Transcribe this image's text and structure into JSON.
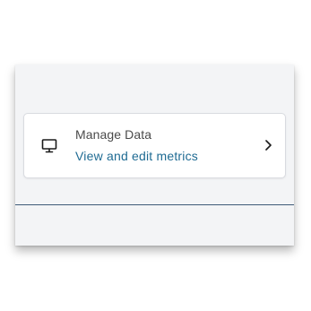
{
  "manage_card": {
    "title": "Manage Data",
    "link": "View and edit metrics",
    "icon": "monitor-icon",
    "action_icon": "chevron-right-icon"
  },
  "colors": {
    "link": "#1f6b93",
    "divider": "#3e5a78",
    "panel_background": "#f3f4f6"
  }
}
